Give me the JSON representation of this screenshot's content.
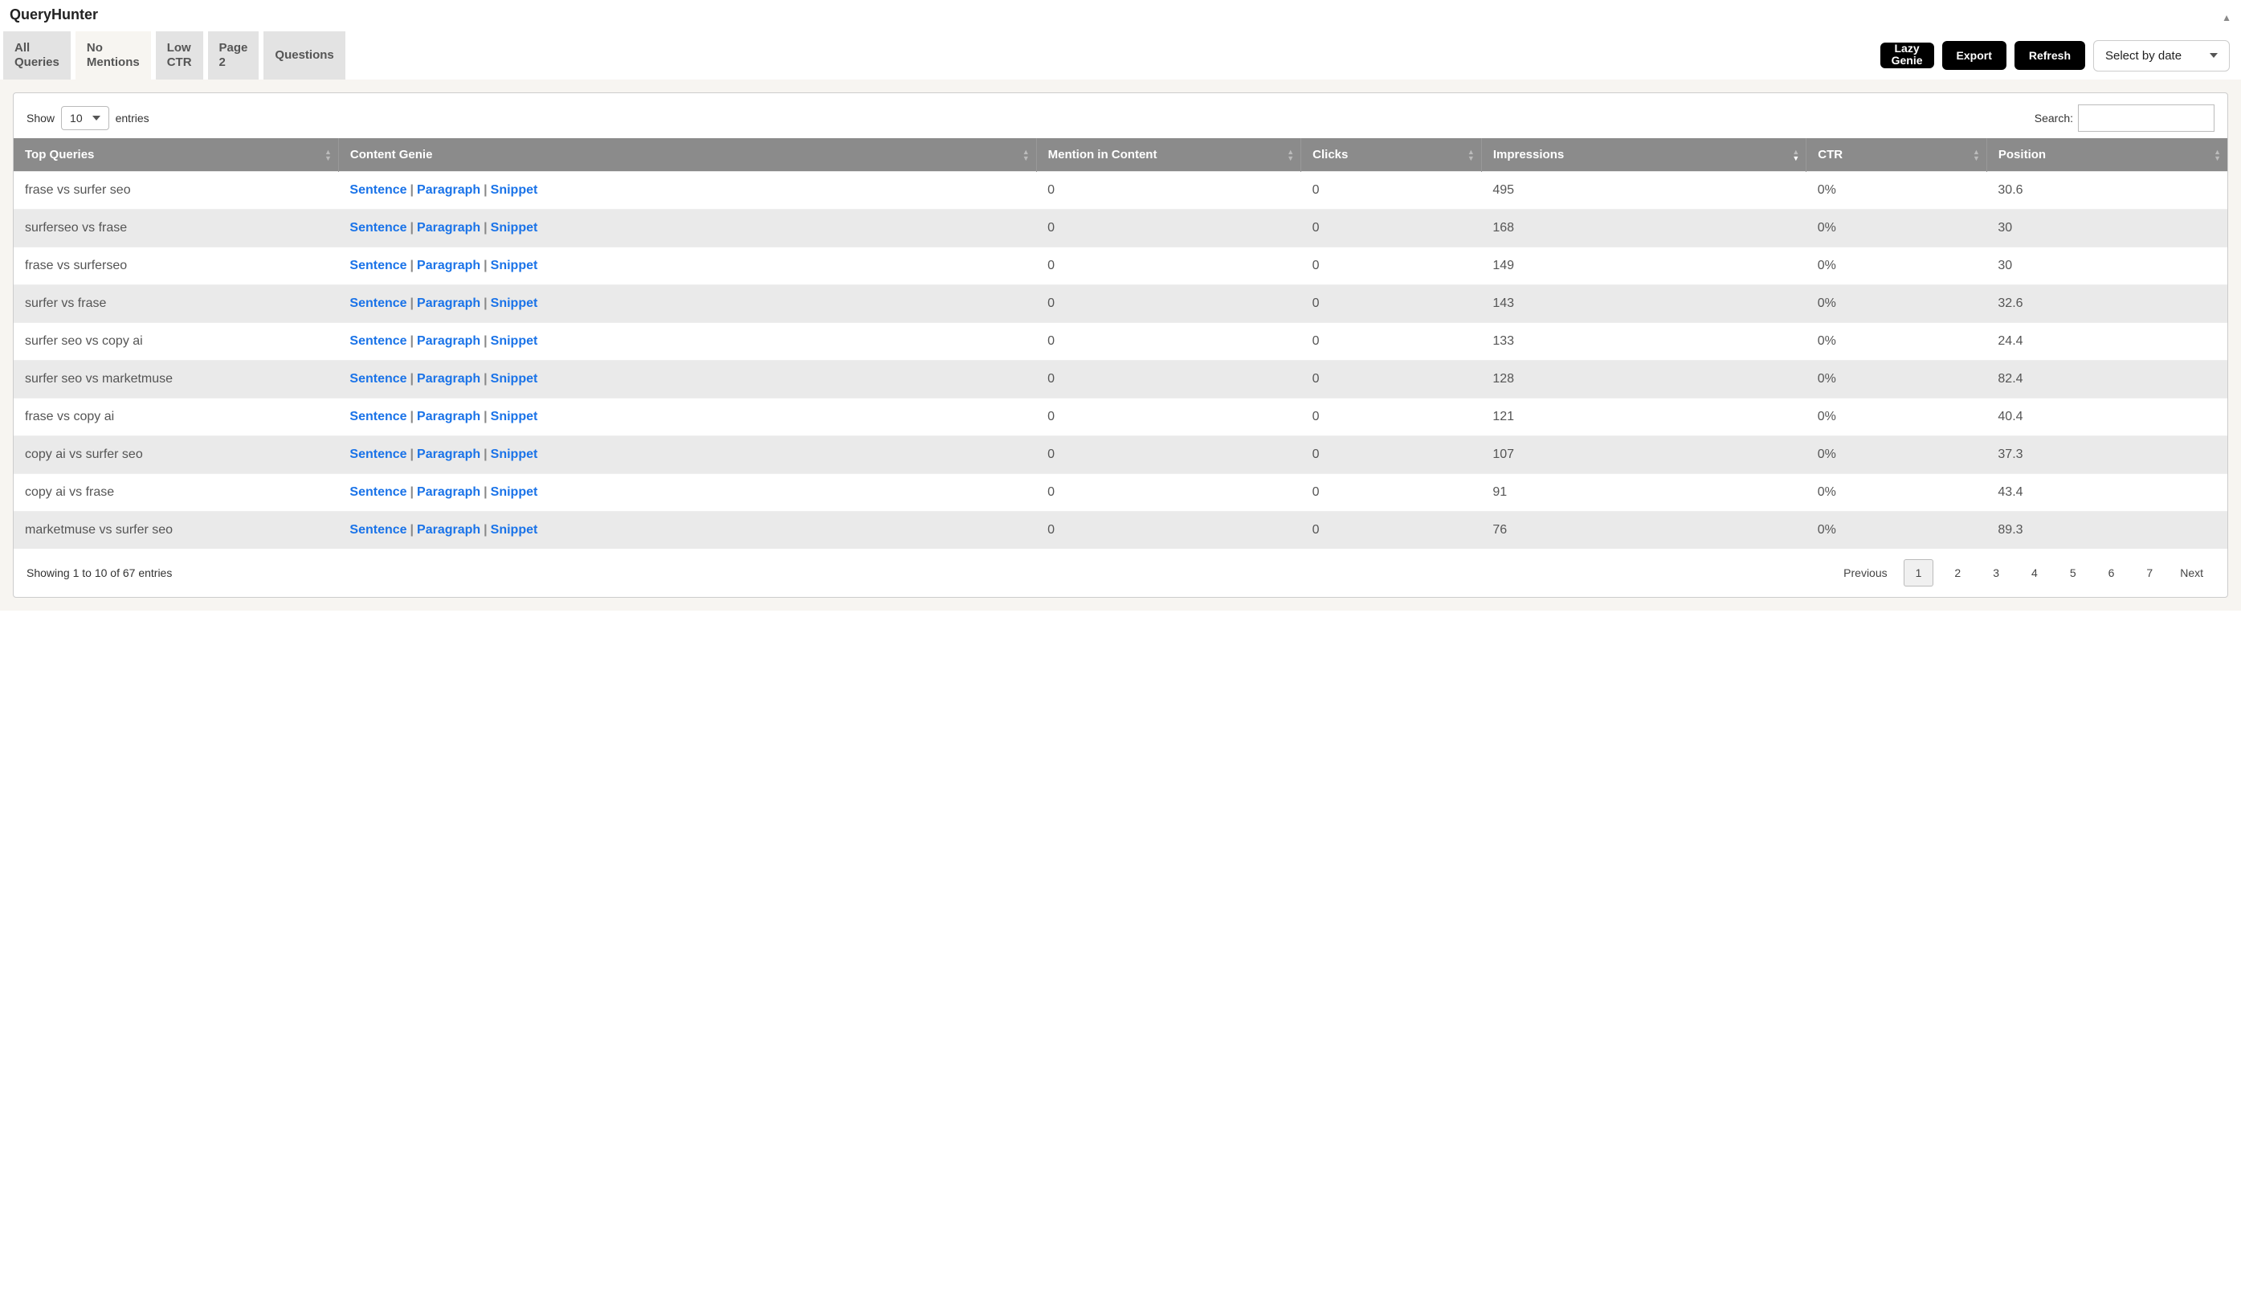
{
  "app": {
    "title": "QueryHunter"
  },
  "tabs": [
    {
      "label": "All\nQueries"
    },
    {
      "label": "No\nMentions"
    },
    {
      "label": "Low\nCTR"
    },
    {
      "label": "Page\n2"
    },
    {
      "label": "Questions"
    }
  ],
  "buttons": {
    "lazy_genie": "Lazy\nGenie",
    "export": "Export",
    "refresh": "Refresh"
  },
  "date_select": {
    "label": "Select by date"
  },
  "length": {
    "show": "Show",
    "value": "10",
    "entries": "entries"
  },
  "search": {
    "label": "Search:",
    "value": ""
  },
  "columns": {
    "top_queries": "Top Queries",
    "content_genie": "Content Genie",
    "mention": "Mention in Content",
    "clicks": "Clicks",
    "impressions": "Impressions",
    "ctr": "CTR",
    "position": "Position"
  },
  "genie_actions": {
    "sentence": "Sentence",
    "paragraph": "Paragraph",
    "snippet": "Snippet"
  },
  "rows": [
    {
      "query": "frase vs surfer seo",
      "mention": "0",
      "clicks": "0",
      "impressions": "495",
      "ctr": "0%",
      "position": "30.6"
    },
    {
      "query": "surferseo vs frase",
      "mention": "0",
      "clicks": "0",
      "impressions": "168",
      "ctr": "0%",
      "position": "30"
    },
    {
      "query": "frase vs surferseo",
      "mention": "0",
      "clicks": "0",
      "impressions": "149",
      "ctr": "0%",
      "position": "30"
    },
    {
      "query": "surfer vs frase",
      "mention": "0",
      "clicks": "0",
      "impressions": "143",
      "ctr": "0%",
      "position": "32.6"
    },
    {
      "query": "surfer seo vs copy ai",
      "mention": "0",
      "clicks": "0",
      "impressions": "133",
      "ctr": "0%",
      "position": "24.4"
    },
    {
      "query": "surfer seo vs marketmuse",
      "mention": "0",
      "clicks": "0",
      "impressions": "128",
      "ctr": "0%",
      "position": "82.4"
    },
    {
      "query": "frase vs copy ai",
      "mention": "0",
      "clicks": "0",
      "impressions": "121",
      "ctr": "0%",
      "position": "40.4"
    },
    {
      "query": "copy ai vs surfer seo",
      "mention": "0",
      "clicks": "0",
      "impressions": "107",
      "ctr": "0%",
      "position": "37.3"
    },
    {
      "query": "copy ai vs frase",
      "mention": "0",
      "clicks": "0",
      "impressions": "91",
      "ctr": "0%",
      "position": "43.4"
    },
    {
      "query": "marketmuse vs surfer seo",
      "mention": "0",
      "clicks": "0",
      "impressions": "76",
      "ctr": "0%",
      "position": "89.3"
    }
  ],
  "footer": {
    "info": "Showing 1 to 10 of 67 entries",
    "prev": "Previous",
    "next": "Next",
    "pages": [
      "1",
      "2",
      "3",
      "4",
      "5",
      "6",
      "7"
    ],
    "active": "1"
  }
}
